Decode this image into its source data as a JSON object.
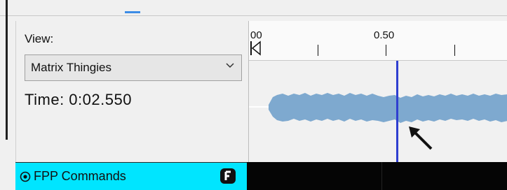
{
  "view": {
    "label": "View:",
    "selected": "Matrix Thingies",
    "time_readout": "Time: 0:02.550"
  },
  "ruler": {
    "start_label": "00",
    "mark_label": "0.50"
  },
  "playhead": {
    "time": "0:02.550"
  },
  "bottom_bar": {
    "label": "FPP Commands",
    "badge_icon": "f-badge-icon"
  },
  "colors": {
    "accent": "#3c8ce6",
    "playhead": "#2f3fd0",
    "waveform": "#7ea9cf",
    "bottom_bar": "#00e5ff"
  }
}
